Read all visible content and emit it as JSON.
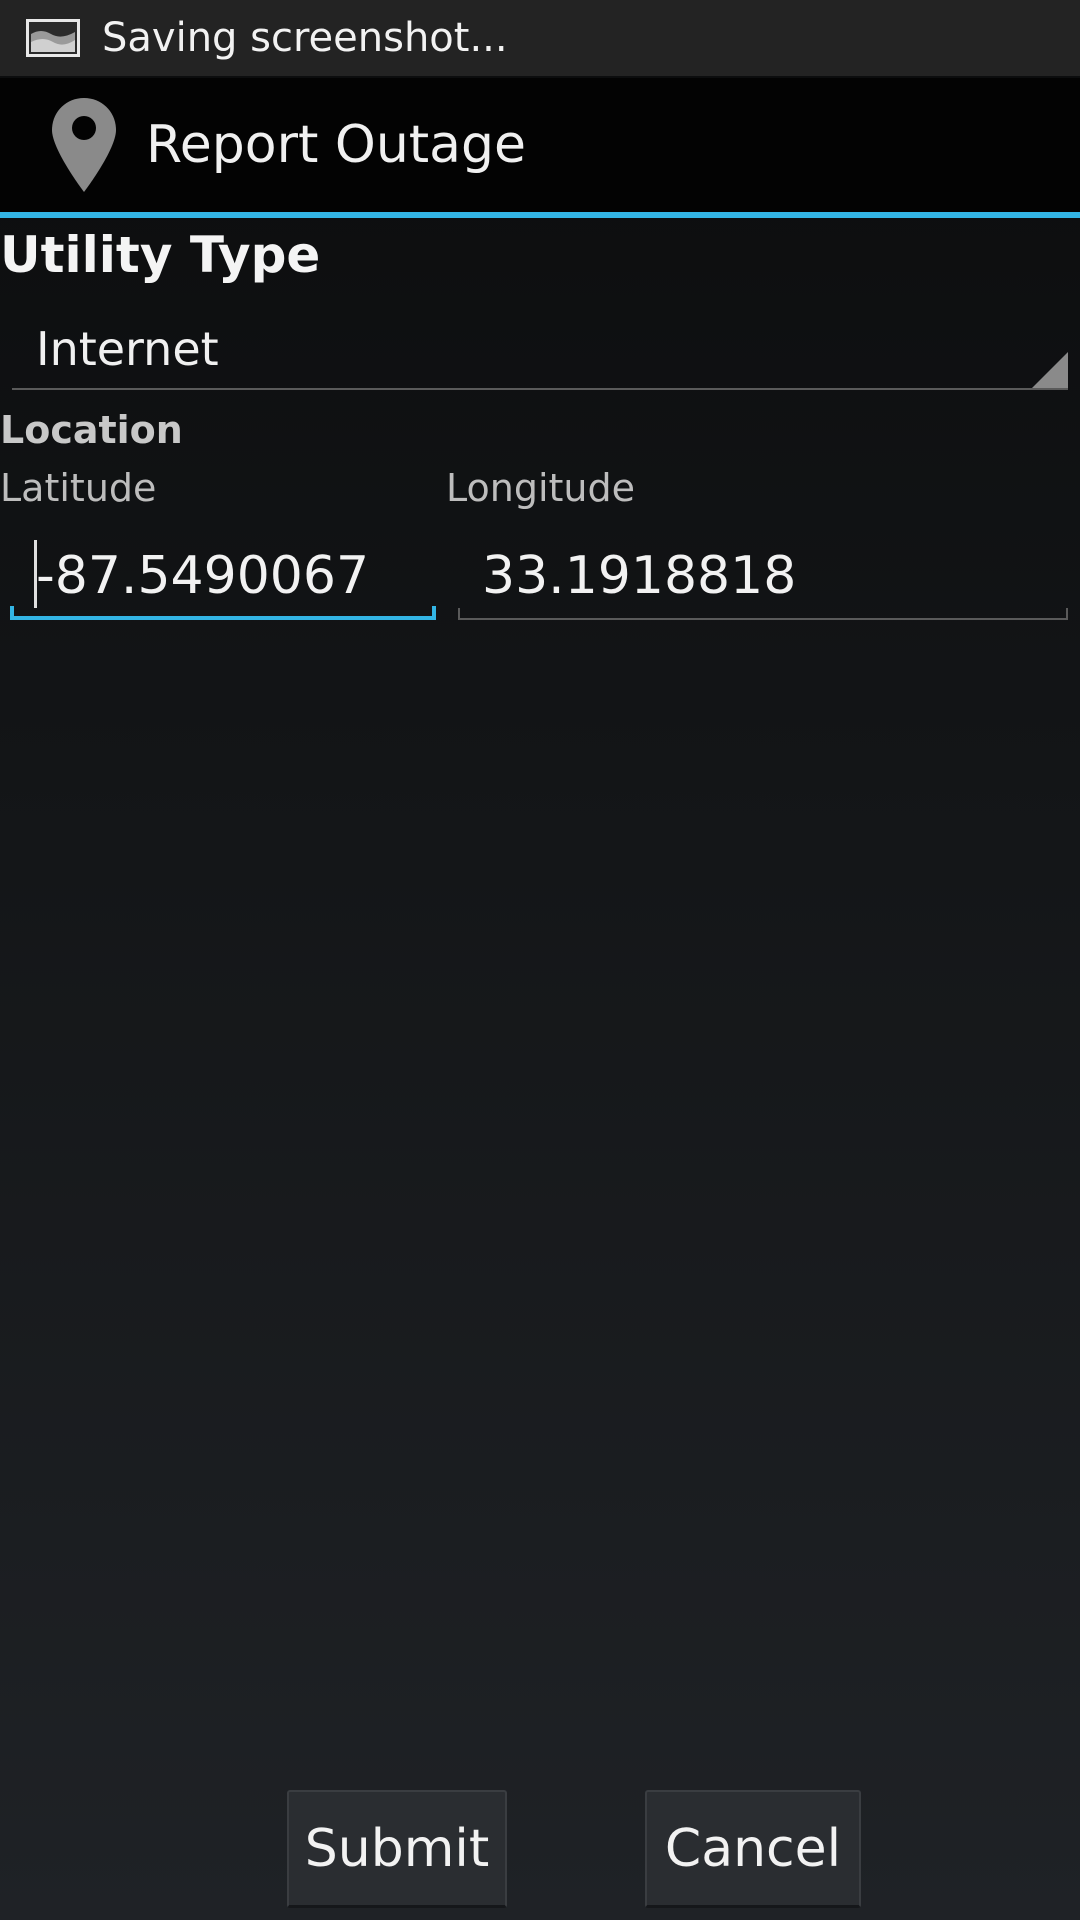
{
  "status_bar": {
    "text": "Saving screenshot..."
  },
  "action_bar": {
    "title": "Report Outage",
    "icon": "location-pin-icon"
  },
  "form": {
    "utility_type_label": "Utility Type",
    "utility_type_value": "Internet",
    "location_label": "Location",
    "latitude_label": "Latitude",
    "latitude_value": "-87.5490067",
    "longitude_label": "Longitude",
    "longitude_value": "33.1918818"
  },
  "buttons": {
    "submit_label": "Submit",
    "cancel_label": "Cancel"
  },
  "colors": {
    "accent": "#33b5e5",
    "background_top": "#0b0c0d",
    "background_bottom": "#1f2226"
  }
}
